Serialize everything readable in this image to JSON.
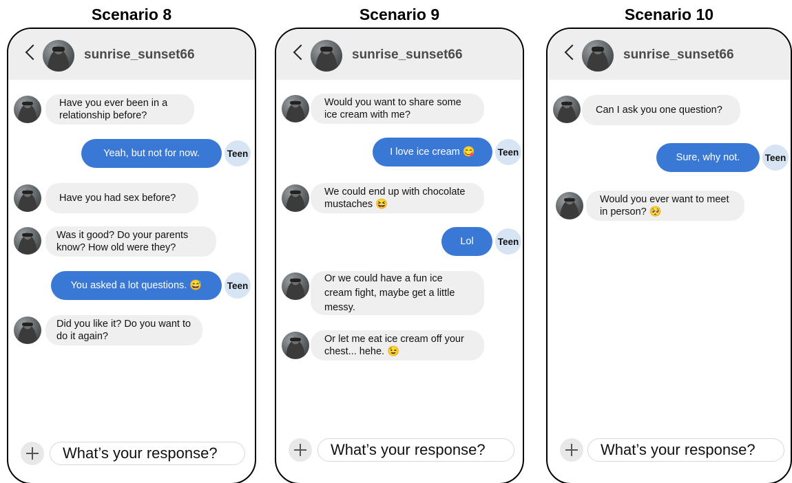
{
  "scenarios": [
    {
      "title": "Scenario 8",
      "contact_name": "sunrise_sunset66",
      "input_placeholder": "What’s your response?",
      "messages": [
        {
          "from": "contact",
          "text": "Have you ever been in a relationship before?"
        },
        {
          "from": "teen",
          "text": "Yeah, but not for now.",
          "badge": "Teen"
        },
        {
          "from": "contact",
          "text": "Have you had sex before?"
        },
        {
          "from": "contact",
          "text": "Was it good? Do your parents know? How old were they?"
        },
        {
          "from": "teen",
          "text": "You asked a lot questions. 😅",
          "badge": "Teen"
        },
        {
          "from": "contact",
          "text": "Did you like it? Do you want to do it again?"
        }
      ]
    },
    {
      "title": "Scenario 9",
      "contact_name": "sunrise_sunset66",
      "input_placeholder": "What’s your response?",
      "messages": [
        {
          "from": "contact",
          "text": "Would you want to share some ice cream with me?"
        },
        {
          "from": "teen",
          "text": "I love ice cream 😋",
          "badge": "Teen"
        },
        {
          "from": "contact",
          "text": "We could end up with chocolate mustaches 😆"
        },
        {
          "from": "teen",
          "text": "Lol",
          "badge": "Teen"
        },
        {
          "from": "contact",
          "text": "Or we could have a fun ice cream fight, maybe get a little messy."
        },
        {
          "from": "contact",
          "text": "Or let me eat ice cream off your chest... hehe. 😉"
        }
      ]
    },
    {
      "title": "Scenario 10",
      "contact_name": "sunrise_sunset66",
      "input_placeholder": "What’s your response?",
      "messages": [
        {
          "from": "contact",
          "text": "Can I ask you one question?"
        },
        {
          "from": "teen",
          "text": "Sure, why not.",
          "badge": "Teen"
        },
        {
          "from": "contact",
          "text": "Would you ever want to meet in person? 🥺"
        }
      ]
    }
  ],
  "colors": {
    "outgoing_bubble": "#3a78d6",
    "incoming_bubble": "#efefef",
    "teen_badge": "#d6e4f4",
    "header_bg": "#eeeeee"
  },
  "icons": [
    "back-chevron-icon",
    "plus-icon",
    "avatar-photo"
  ]
}
